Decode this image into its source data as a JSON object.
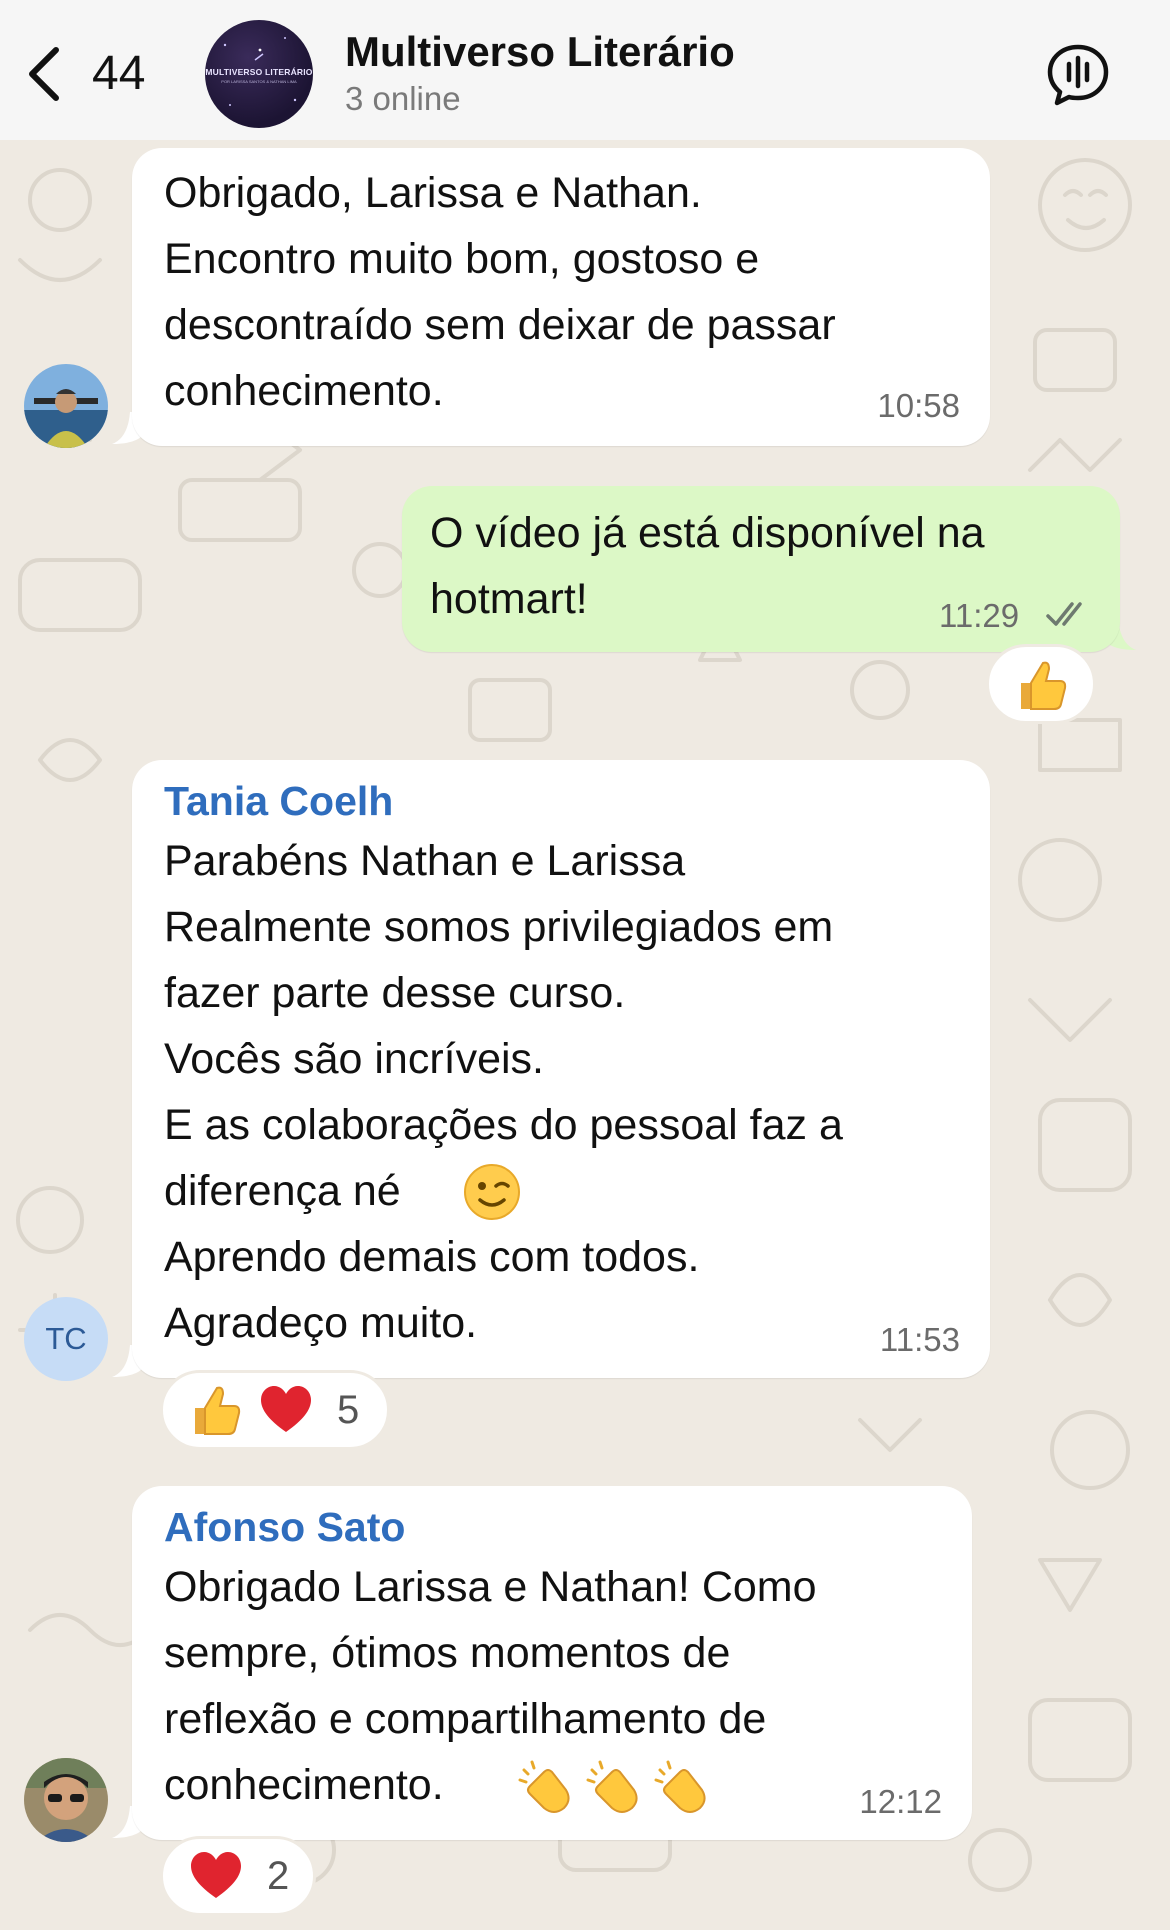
{
  "header": {
    "back_count": "44",
    "group_name": "Multiverso Literário",
    "group_status": "3 online",
    "avatar_title": "MULTIVERSO LITERÁRIO",
    "avatar_subtitle": "POR LARISSA SANTOS & NATHAN LIMA"
  },
  "messages": [
    {
      "direction": "incoming",
      "sender": "",
      "text": "Obrigado, Larissa e Nathan.\nEncontro muito bom, gostoso e\ndescontraído sem deixar de passar\nconhecimento.",
      "time": "10:58"
    },
    {
      "direction": "outgoing",
      "text": "O vídeo já está disponível na\nhotmart!",
      "time": "11:29",
      "status": "read",
      "reactions": [
        {
          "emoji": "thumbs-up",
          "count": ""
        }
      ]
    },
    {
      "direction": "incoming",
      "sender": "Tania Coelh",
      "avatar_initials": "TC",
      "text": "Parabéns Nathan e Larissa\nRealmente somos privilegiados em\nfazer parte desse curso.\nVocês são incríveis.\nE as colaborações do pessoal faz a\ndiferença né \nAprendo demais com todos.\nAgradeço muito.",
      "inline_emoji": "winking-face",
      "time": "11:53",
      "reactions": [
        {
          "emoji": "thumbs-up"
        },
        {
          "emoji": "red-heart"
        }
      ],
      "reaction_count": "5"
    },
    {
      "direction": "incoming",
      "sender": "Afonso  Sato",
      "text": "Obrigado Larissa e Nathan! Como\nsempre, ótimos momentos de\nreflexão e compartilhamento de\nconhecimento. ",
      "inline_emojis": [
        "clapping-hands",
        "clapping-hands",
        "clapping-hands"
      ],
      "time": "12:12",
      "reactions": [
        {
          "emoji": "red-heart"
        }
      ],
      "reaction_count": "2"
    }
  ],
  "colors": {
    "chat_background": "#efeae2",
    "incoming_bubble": "#ffffff",
    "outgoing_bubble": "#dcf8c6",
    "sender_name": "#2f6dbd",
    "header": "#f6f6f6"
  }
}
